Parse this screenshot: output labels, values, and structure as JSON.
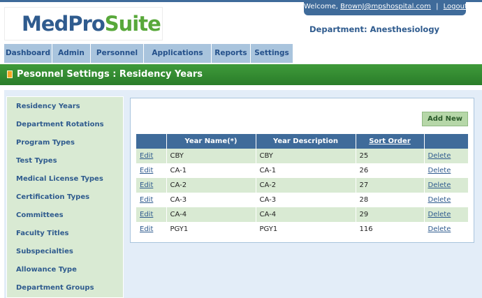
{
  "header": {
    "logo_part1": "MedPro",
    "logo_part2": "Suite",
    "welcome_label": "Welcome,",
    "user_email": "BrownJ@mpshospital.com",
    "separator": "|",
    "logout_label": "Logout",
    "department": "Department: Anesthesiology"
  },
  "nav": {
    "tabs": [
      {
        "label": "Dashboard"
      },
      {
        "label": "Admin"
      },
      {
        "label": "Personnel"
      },
      {
        "label": "Applications"
      },
      {
        "label": "Reports"
      },
      {
        "label": "Settings"
      }
    ]
  },
  "page": {
    "title": "Pesonnel Settings : Residency Years"
  },
  "sidebar": {
    "items": [
      {
        "label": "Residency Years"
      },
      {
        "label": "Department Rotations"
      },
      {
        "label": "Program Types"
      },
      {
        "label": "Test Types"
      },
      {
        "label": "Medical License Types"
      },
      {
        "label": "Certification Types"
      },
      {
        "label": "Committees"
      },
      {
        "label": "Faculty Titles"
      },
      {
        "label": "Subspecialties"
      },
      {
        "label": "Allowance Type"
      },
      {
        "label": "Department Groups"
      }
    ]
  },
  "main": {
    "add_new_label": "Add New",
    "columns": [
      "",
      "Year Name(*)",
      "Year Description",
      "Sort Order",
      ""
    ],
    "rows": [
      {
        "edit": "Edit",
        "name": "CBY",
        "description": "CBY",
        "sort": "25",
        "delete": "Delete"
      },
      {
        "edit": "Edit",
        "name": "CA-1",
        "description": "CA-1",
        "sort": "26",
        "delete": "Delete"
      },
      {
        "edit": "Edit",
        "name": "CA-2",
        "description": "CA-2",
        "sort": "27",
        "delete": "Delete"
      },
      {
        "edit": "Edit",
        "name": "CA-3",
        "description": "CA-3",
        "sort": "28",
        "delete": "Delete"
      },
      {
        "edit": "Edit",
        "name": "CA-4",
        "description": "CA-4",
        "sort": "29",
        "delete": "Delete"
      },
      {
        "edit": "Edit",
        "name": "PGY1",
        "description": "PGY1",
        "sort": "116",
        "delete": "Delete"
      }
    ]
  },
  "colors": {
    "brand_blue": "#2f5b8e",
    "brand_green": "#58a83a",
    "header_bar": "#2a7d2a",
    "row_highlight": "#d9ead3"
  }
}
